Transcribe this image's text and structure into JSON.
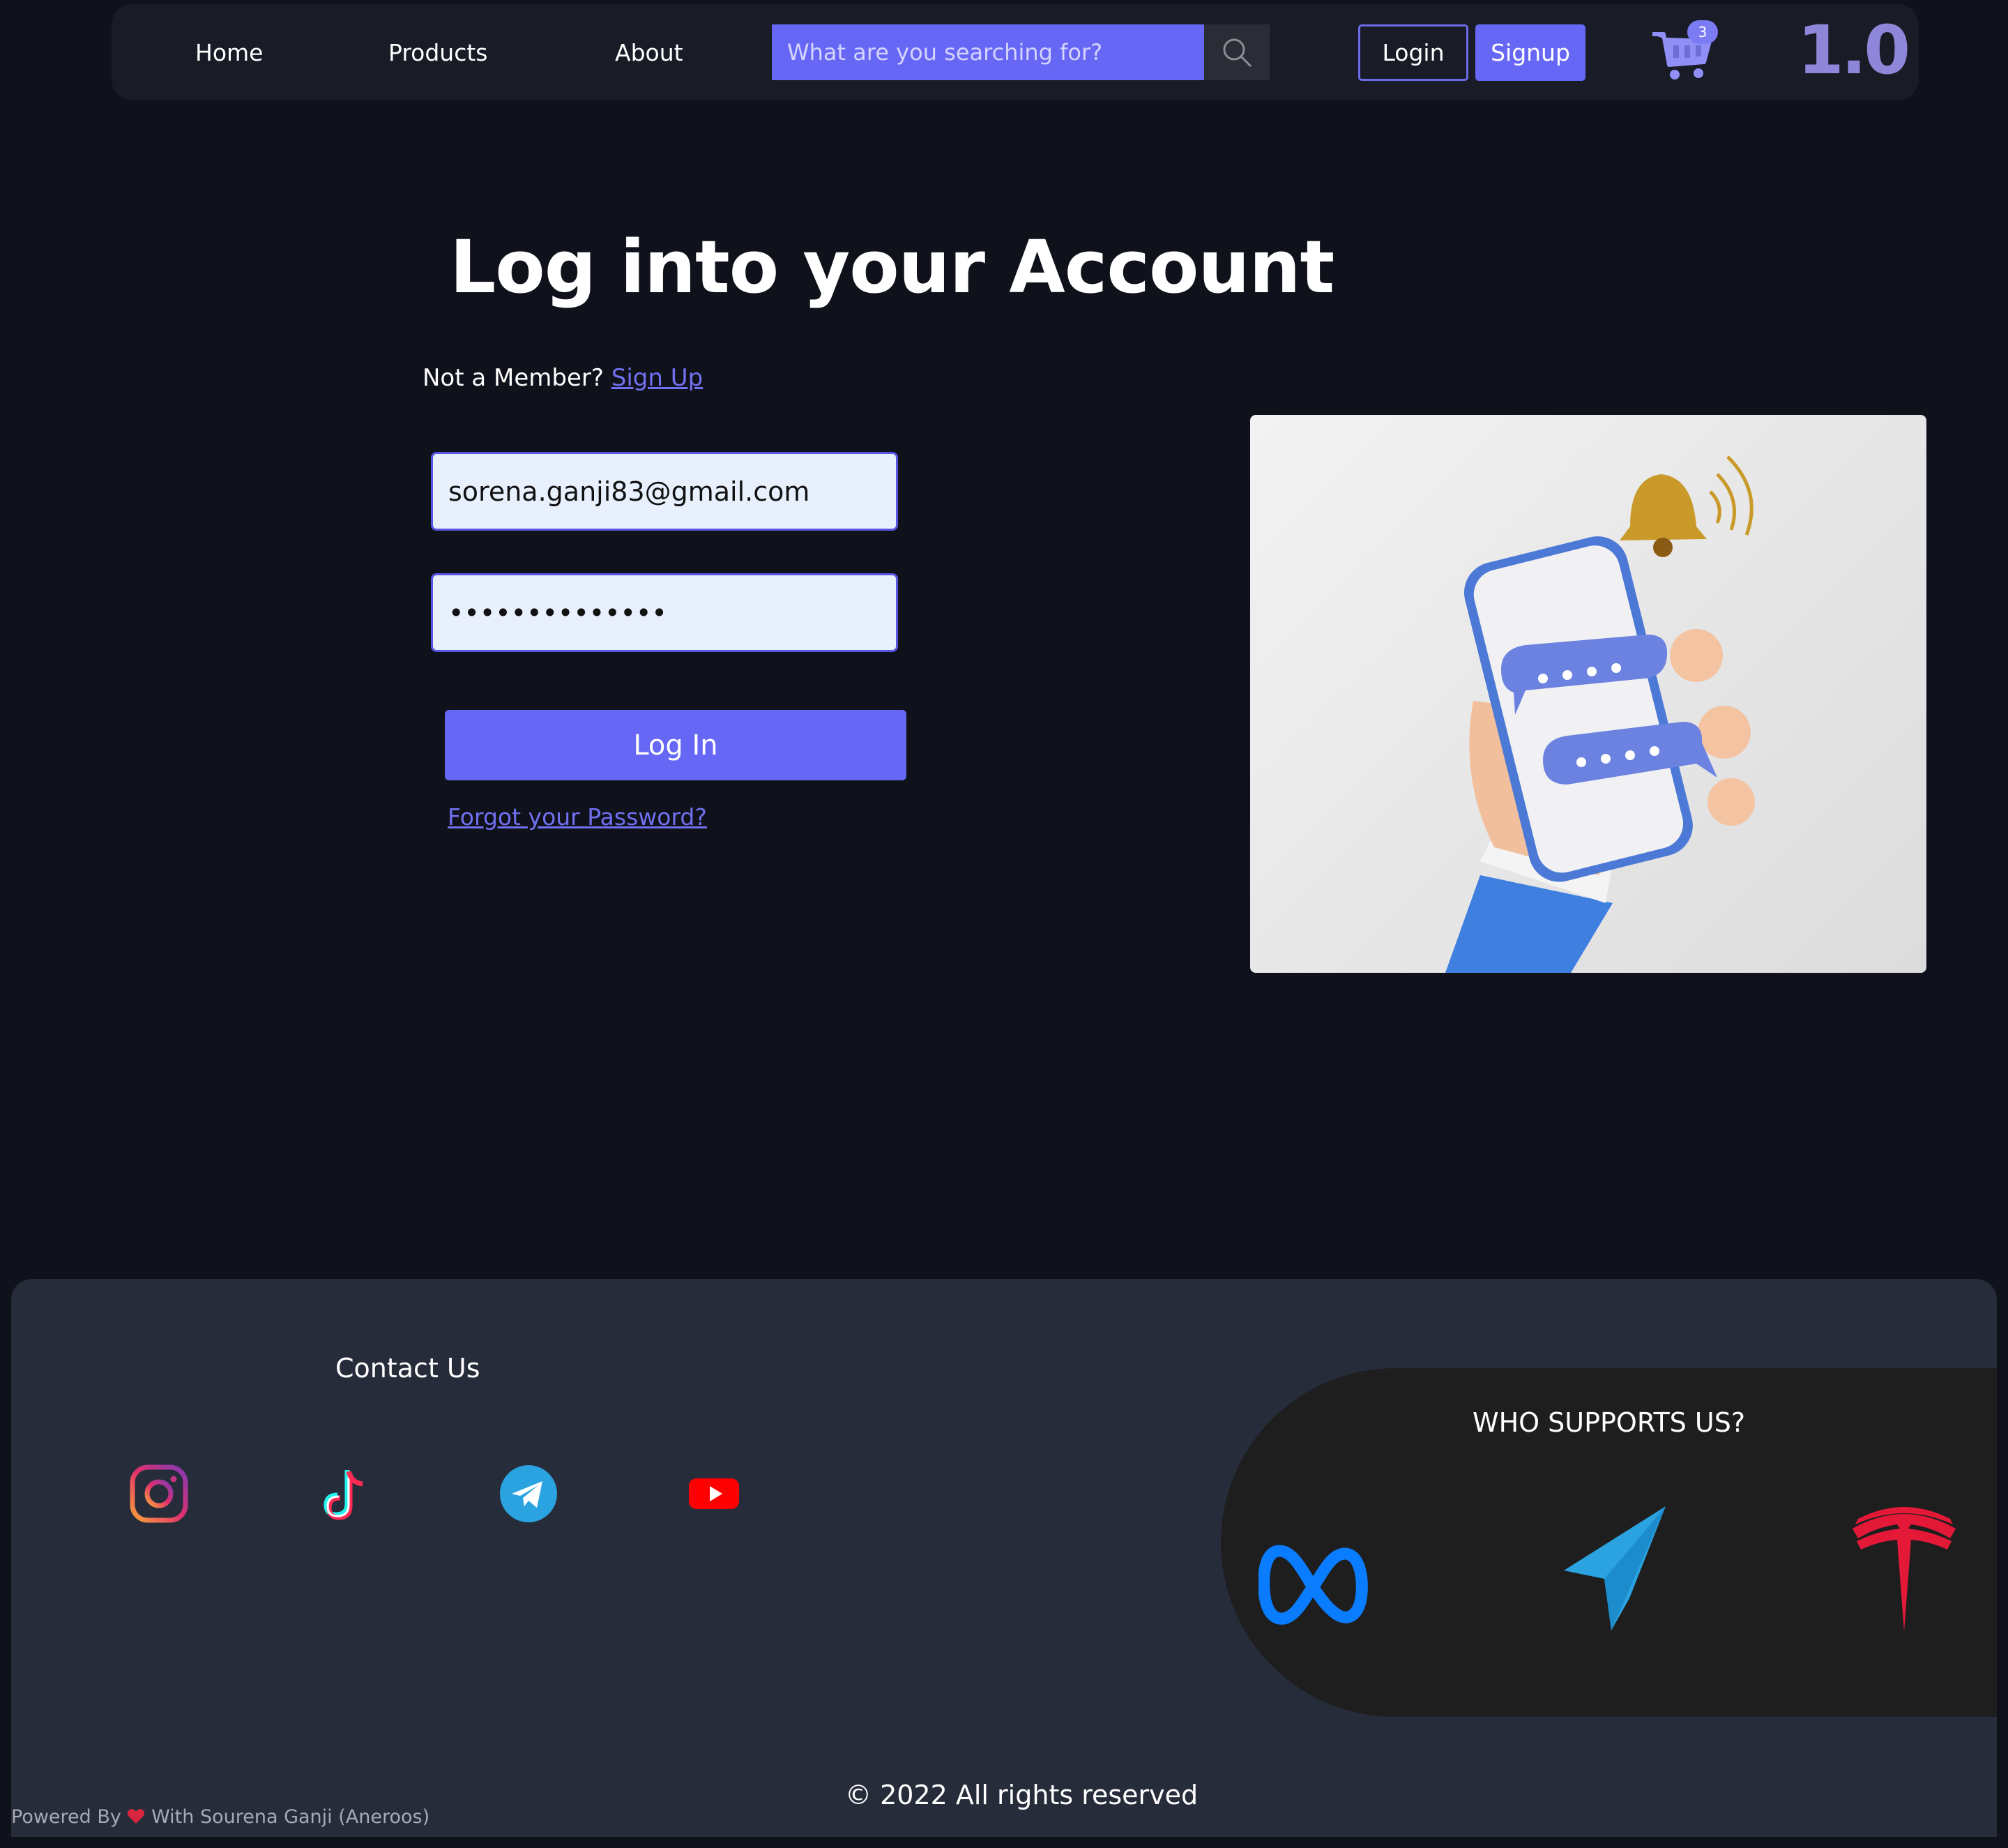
{
  "nav": {
    "links": [
      "Home",
      "Products",
      "About"
    ],
    "search_placeholder": "What are you searching for?",
    "login_label": "Login",
    "signup_label": "Signup",
    "cart_count": "3",
    "version": "1.0"
  },
  "login": {
    "title": "Log into your Account",
    "member_prompt": "Not a Member?",
    "signup_link": "Sign Up",
    "email_value": "sorena.ganji83@gmail.com",
    "password_value": "••••••••••••••",
    "submit_label": "Log In",
    "forgot_label": "Forgot your Password?"
  },
  "footer": {
    "contact_title": "Contact Us",
    "social_icons": [
      "instagram-icon",
      "tiktok-icon",
      "telegram-icon",
      "youtube-icon"
    ],
    "supporters_title": "WHO SUPPORTS US?",
    "supporter_logos": [
      "meta-logo",
      "telegram-logo",
      "tesla-logo"
    ],
    "copyright": "© 2022 All rights reserved",
    "powered_prefix": "Powered By",
    "powered_suffix": "With Sourena Ganji (Aneroos)"
  },
  "colors": {
    "page_bg": "#0f111b",
    "nav_bg": "#191b27",
    "accent": "#6767f5",
    "footer_bg": "#272c3b",
    "supporters_bg": "#1e1e1f"
  }
}
